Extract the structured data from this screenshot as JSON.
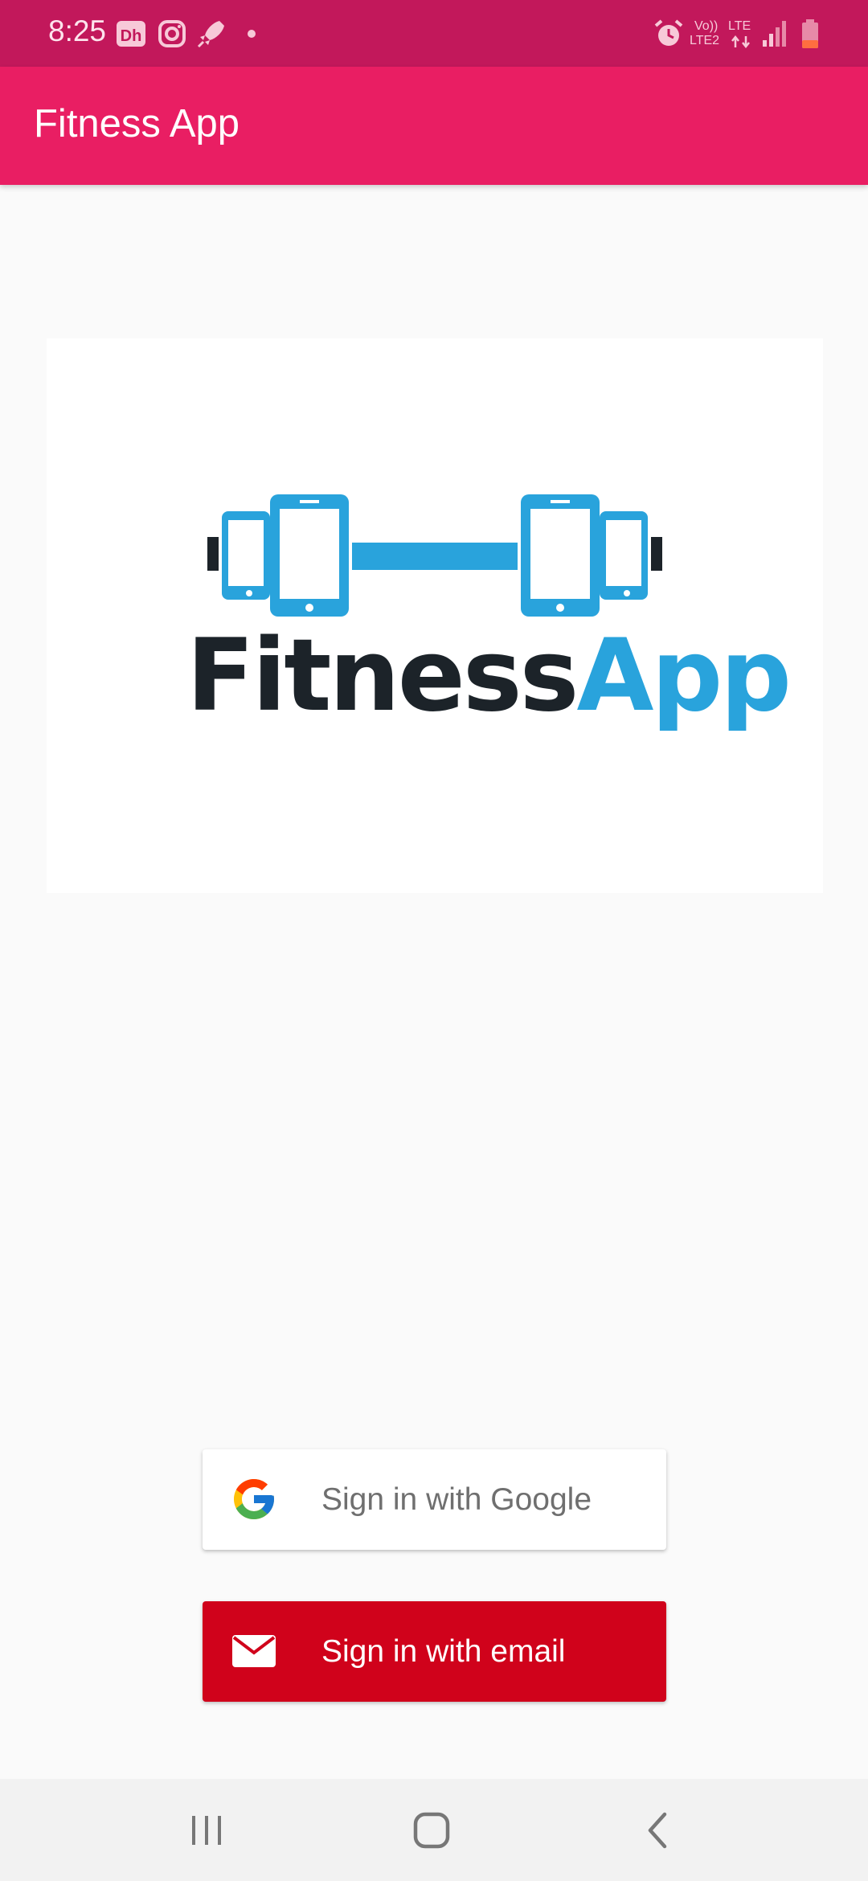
{
  "status_bar": {
    "time": "8:25",
    "left_icons": [
      "disney-hotstar-icon",
      "instagram-icon",
      "rocket-icon",
      "dot-icon"
    ],
    "right_icons": [
      "alarm-icon",
      "volte-lte2-icon",
      "lte-data-icon",
      "signal-icon",
      "battery-low-icon"
    ],
    "volte_text": "Vo))",
    "lte2_text": "LTE2",
    "lte_text": "LTE"
  },
  "app_bar": {
    "title": "Fitness App"
  },
  "logo": {
    "word_part1": "Fitness",
    "word_part2": "App",
    "colors": {
      "dark": "#1c2329",
      "blue": "#29a3dc"
    }
  },
  "buttons": {
    "google": {
      "label": "Sign in with Google",
      "icon": "google-g-icon"
    },
    "email": {
      "label": "Sign in with email",
      "icon": "envelope-icon"
    }
  },
  "nav_bar": {
    "items": [
      "recent-apps-icon",
      "home-icon",
      "back-icon"
    ]
  },
  "colors": {
    "status_bar": "#c2185b",
    "app_bar": "#e91e63",
    "email_button": "#d0021b",
    "background": "#fafafa"
  }
}
